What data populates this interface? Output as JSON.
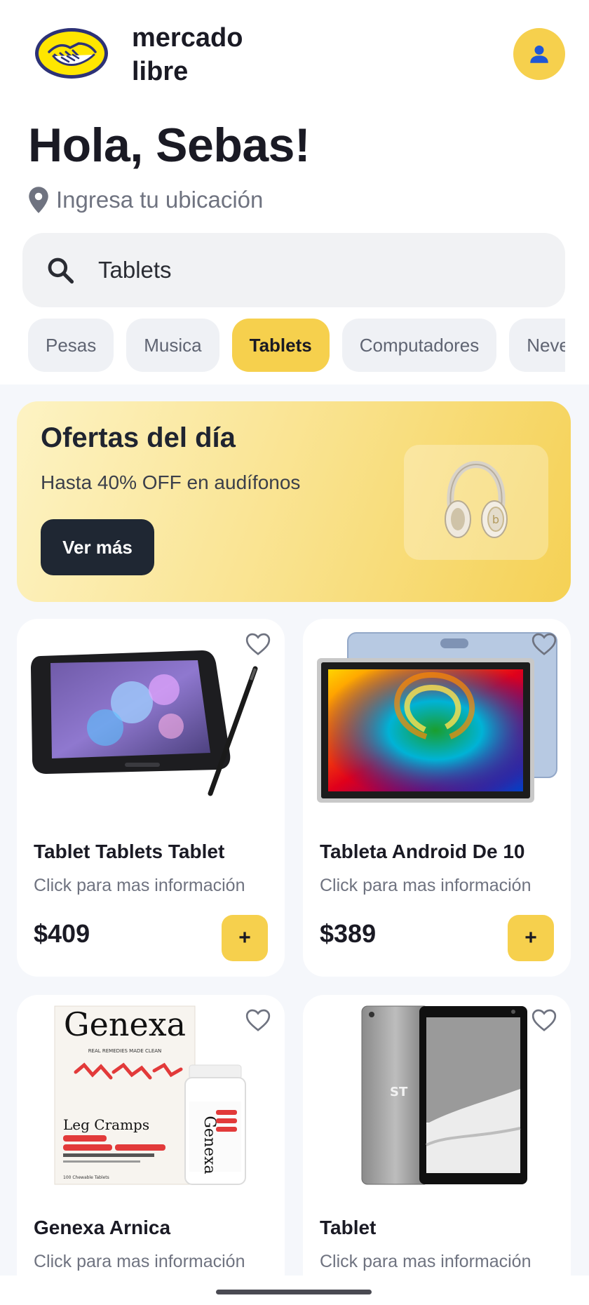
{
  "app": {
    "brand_line1": "mercado",
    "brand_line2": "libre"
  },
  "greeting": "Hola, Sebas!",
  "location": {
    "placeholder": "Ingresa tu ubicación"
  },
  "search": {
    "value": "Tablets"
  },
  "chips": [
    {
      "label": "Pesas",
      "active": false
    },
    {
      "label": "Musica",
      "active": false
    },
    {
      "label": "Tablets",
      "active": true
    },
    {
      "label": "Computadores",
      "active": false
    },
    {
      "label": "Neveras",
      "active": false
    }
  ],
  "banner": {
    "title": "Ofertas del día",
    "subtitle": "Hasta 40% OFF en audífonos",
    "cta": "Ver más"
  },
  "products": [
    {
      "name": "Tablet Tablets Tablet",
      "sub": "Click para mas información",
      "price": "$409",
      "add": "+"
    },
    {
      "name": "Tableta Android De 10",
      "sub": "Click para mas información",
      "price": "$389",
      "add": "+"
    },
    {
      "name": "Genexa Arnica",
      "sub": "Click para mas información",
      "price": "",
      "add": "+"
    },
    {
      "name": "Tablet",
      "sub": "Click para mas información",
      "price": "",
      "add": "+"
    }
  ],
  "genexa": {
    "brand": "Genexa",
    "tagline": "REAL REMEDIES MADE CLEAN",
    "product": "Leg Cramps",
    "count": "100 Chewable Tablets"
  },
  "colors": {
    "accent": "#f6d04d",
    "dark": "#1f2733",
    "background": "#f5f7fb"
  }
}
